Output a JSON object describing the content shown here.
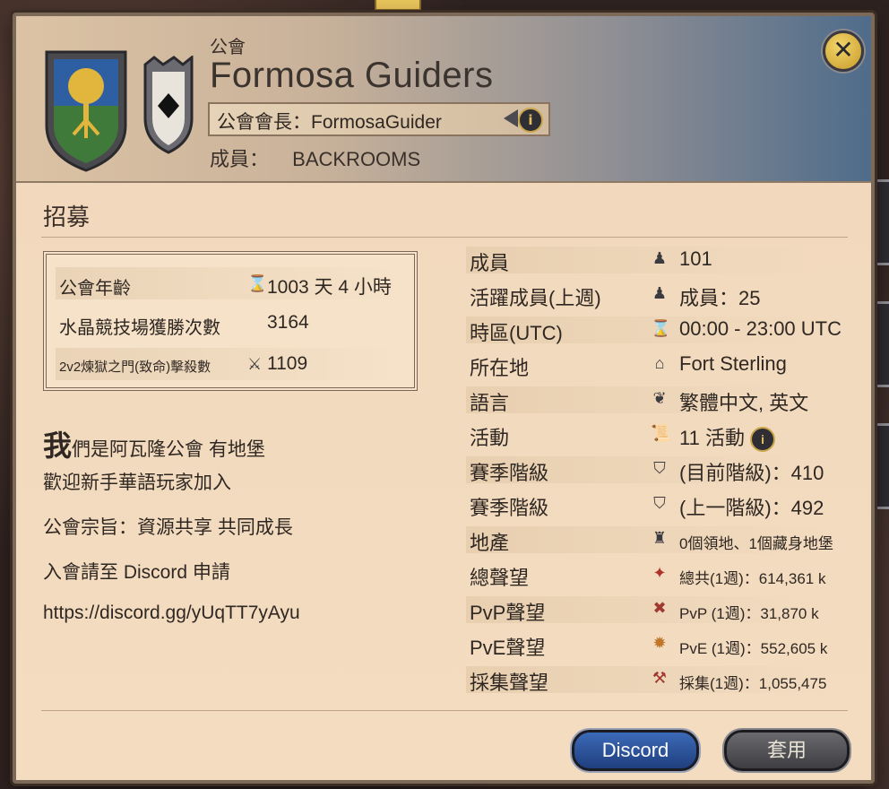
{
  "header": {
    "guild_label": "公會",
    "guild_name": "Formosa Guiders",
    "leader_text": "公會會長：FormosaGuider",
    "members_label": "成員：",
    "members_value": "BACKROOMS",
    "info_glyph": "i",
    "close_glyph": "✕"
  },
  "recruit": {
    "title": "招募"
  },
  "stats": [
    {
      "label": "公會年齡",
      "icon": "hourglass-icon",
      "glyph": "⌛",
      "value": "1003 天 4 小時"
    },
    {
      "label": "水晶競技場獲勝次數",
      "icon": "",
      "glyph": "",
      "value": "3164"
    },
    {
      "label": "2v2煉獄之門(致命)擊殺數",
      "icon": "swords-icon",
      "glyph": "⚔",
      "value": "1109"
    }
  ],
  "description": [
    {
      "first": "我",
      "rest": "們是阿瓦隆公會 有地堡"
    },
    "歡迎新手華語玩家加入",
    "公會宗旨：資源共享 共同成長",
    "入會請至 Discord 申請",
    "https://discord.gg/yUqTT7yAyu"
  ],
  "info": [
    {
      "label": "成員",
      "icon": "member-icon",
      "glyph": "♟",
      "value": "101"
    },
    {
      "label": "活躍成員(上週)",
      "icon": "active-member-icon",
      "glyph": "♟",
      "value": "成員：25"
    },
    {
      "label": "時區(UTC)",
      "icon": "hourglass-icon",
      "glyph": "⌛",
      "value": "00:00 - 23:00 UTC"
    },
    {
      "label": "所在地",
      "icon": "home-icon",
      "glyph": "⌂",
      "value": "Fort Sterling"
    },
    {
      "label": "語言",
      "icon": "language-icon",
      "glyph": "❦",
      "value": "繁體中文, 英文"
    },
    {
      "label": "活動",
      "icon": "scroll-icon",
      "glyph": "📜",
      "value": "11 活動"
    },
    {
      "label": "賽季階級",
      "icon": "crest-icon",
      "glyph": "⛉",
      "value": "(目前階級)：410"
    },
    {
      "label": "賽季階級",
      "icon": "crest-icon",
      "glyph": "⛉",
      "value": "(上一階級)：492"
    },
    {
      "label": "地產",
      "icon": "castle-icon",
      "glyph": "♜",
      "value": "0個領地、1個藏身地堡"
    },
    {
      "label": "總聲望",
      "icon": "total-fame-icon",
      "glyph": "✦",
      "value": "總共(1週)：614,361 k"
    },
    {
      "label": "PvP聲望",
      "icon": "pvp-fame-icon",
      "glyph": "✖",
      "value": "PvP (1週)：31,870 k"
    },
    {
      "label": "PvE聲望",
      "icon": "pve-fame-icon",
      "glyph": "✹",
      "value": "PvE (1週)：552,605 k"
    },
    {
      "label": "採集聲望",
      "icon": "gathering-fame-icon",
      "glyph": "⚒",
      "value": "採集(1週)：1,055,475"
    }
  ],
  "buttons": {
    "discord": "Discord",
    "apply": "套用"
  },
  "colors": {
    "discord_button": "#2c55a0",
    "panel_bg": "#f3dcc0",
    "header_blue": "#4f6c8a"
  }
}
